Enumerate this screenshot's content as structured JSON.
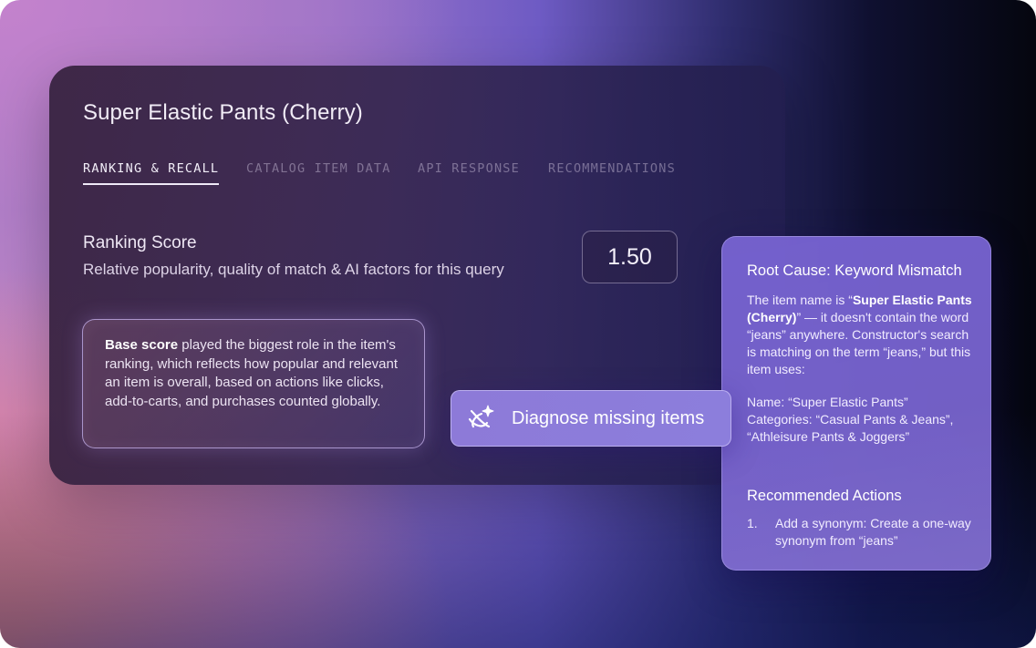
{
  "main": {
    "title": "Super Elastic Pants (Cherry)",
    "tabs": [
      {
        "label": "RANKING & RECALL",
        "active": true
      },
      {
        "label": "CATALOG ITEM DATA",
        "active": false
      },
      {
        "label": "API RESPONSE",
        "active": false
      },
      {
        "label": "RECOMMENDATIONS",
        "active": false
      }
    ],
    "ranking": {
      "label": "Ranking Score",
      "description": "Relative popularity, quality of match & AI factors for this query",
      "value": "1.50"
    },
    "note": {
      "bold": "Base score",
      "text": " played the biggest role in the item's ranking, which reflects how popular and relevant an item is overall, based on actions like clicks, add-to-carts, and purchases counted globally."
    }
  },
  "diagnose_button": {
    "label": "Diagnose missing items",
    "icon": "sparkle-diagnose-icon"
  },
  "root_cause": {
    "title": "Root Cause: Keyword Mismatch",
    "intro_prefix": "The item name is “",
    "item_name": "Super Elastic Pants (Cherry)",
    "intro_suffix": "” — it doesn't contain the word “jeans” anywhere. Constructor's search is matching on the term “jeans,” but this item uses:",
    "name_line": "Name:  “Super Elastic Pants”",
    "categories_line": "Categories: “Casual Pants & Jeans”, “Athleisure Pants & Joggers”",
    "recommended_title": "Recommended Actions",
    "actions": [
      {
        "num": "1.",
        "text": "Add a synonym: Create a one-way synonym from “jeans”"
      }
    ]
  },
  "colors": {
    "accent": "#8c7edc",
    "panel": "#7662d0"
  }
}
